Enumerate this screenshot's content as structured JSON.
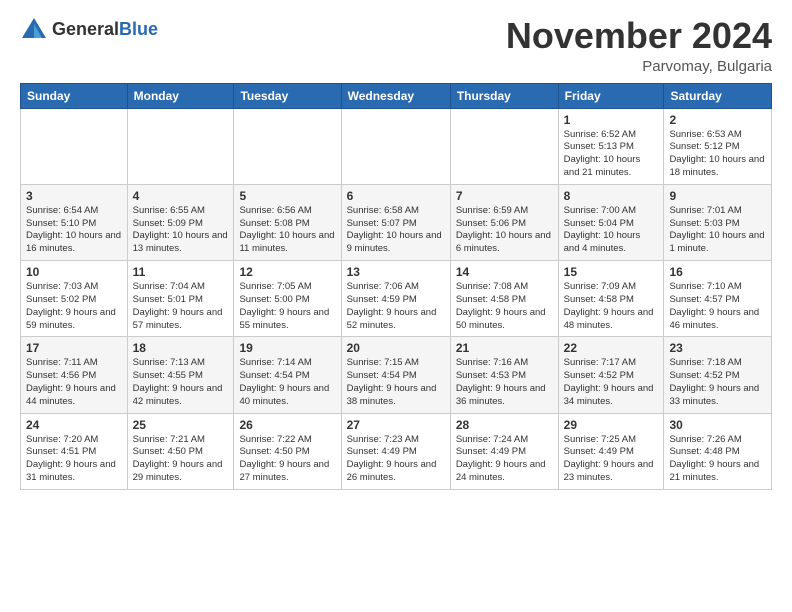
{
  "logo": {
    "text_general": "General",
    "text_blue": "Blue"
  },
  "title": "November 2024",
  "subtitle": "Parvomay, Bulgaria",
  "days_of_week": [
    "Sunday",
    "Monday",
    "Tuesday",
    "Wednesday",
    "Thursday",
    "Friday",
    "Saturday"
  ],
  "weeks": [
    [
      {
        "day": "",
        "info": ""
      },
      {
        "day": "",
        "info": ""
      },
      {
        "day": "",
        "info": ""
      },
      {
        "day": "",
        "info": ""
      },
      {
        "day": "",
        "info": ""
      },
      {
        "day": "1",
        "info": "Sunrise: 6:52 AM\nSunset: 5:13 PM\nDaylight: 10 hours and 21 minutes."
      },
      {
        "day": "2",
        "info": "Sunrise: 6:53 AM\nSunset: 5:12 PM\nDaylight: 10 hours and 18 minutes."
      }
    ],
    [
      {
        "day": "3",
        "info": "Sunrise: 6:54 AM\nSunset: 5:10 PM\nDaylight: 10 hours and 16 minutes."
      },
      {
        "day": "4",
        "info": "Sunrise: 6:55 AM\nSunset: 5:09 PM\nDaylight: 10 hours and 13 minutes."
      },
      {
        "day": "5",
        "info": "Sunrise: 6:56 AM\nSunset: 5:08 PM\nDaylight: 10 hours and 11 minutes."
      },
      {
        "day": "6",
        "info": "Sunrise: 6:58 AM\nSunset: 5:07 PM\nDaylight: 10 hours and 9 minutes."
      },
      {
        "day": "7",
        "info": "Sunrise: 6:59 AM\nSunset: 5:06 PM\nDaylight: 10 hours and 6 minutes."
      },
      {
        "day": "8",
        "info": "Sunrise: 7:00 AM\nSunset: 5:04 PM\nDaylight: 10 hours and 4 minutes."
      },
      {
        "day": "9",
        "info": "Sunrise: 7:01 AM\nSunset: 5:03 PM\nDaylight: 10 hours and 1 minute."
      }
    ],
    [
      {
        "day": "10",
        "info": "Sunrise: 7:03 AM\nSunset: 5:02 PM\nDaylight: 9 hours and 59 minutes."
      },
      {
        "day": "11",
        "info": "Sunrise: 7:04 AM\nSunset: 5:01 PM\nDaylight: 9 hours and 57 minutes."
      },
      {
        "day": "12",
        "info": "Sunrise: 7:05 AM\nSunset: 5:00 PM\nDaylight: 9 hours and 55 minutes."
      },
      {
        "day": "13",
        "info": "Sunrise: 7:06 AM\nSunset: 4:59 PM\nDaylight: 9 hours and 52 minutes."
      },
      {
        "day": "14",
        "info": "Sunrise: 7:08 AM\nSunset: 4:58 PM\nDaylight: 9 hours and 50 minutes."
      },
      {
        "day": "15",
        "info": "Sunrise: 7:09 AM\nSunset: 4:58 PM\nDaylight: 9 hours and 48 minutes."
      },
      {
        "day": "16",
        "info": "Sunrise: 7:10 AM\nSunset: 4:57 PM\nDaylight: 9 hours and 46 minutes."
      }
    ],
    [
      {
        "day": "17",
        "info": "Sunrise: 7:11 AM\nSunset: 4:56 PM\nDaylight: 9 hours and 44 minutes."
      },
      {
        "day": "18",
        "info": "Sunrise: 7:13 AM\nSunset: 4:55 PM\nDaylight: 9 hours and 42 minutes."
      },
      {
        "day": "19",
        "info": "Sunrise: 7:14 AM\nSunset: 4:54 PM\nDaylight: 9 hours and 40 minutes."
      },
      {
        "day": "20",
        "info": "Sunrise: 7:15 AM\nSunset: 4:54 PM\nDaylight: 9 hours and 38 minutes."
      },
      {
        "day": "21",
        "info": "Sunrise: 7:16 AM\nSunset: 4:53 PM\nDaylight: 9 hours and 36 minutes."
      },
      {
        "day": "22",
        "info": "Sunrise: 7:17 AM\nSunset: 4:52 PM\nDaylight: 9 hours and 34 minutes."
      },
      {
        "day": "23",
        "info": "Sunrise: 7:18 AM\nSunset: 4:52 PM\nDaylight: 9 hours and 33 minutes."
      }
    ],
    [
      {
        "day": "24",
        "info": "Sunrise: 7:20 AM\nSunset: 4:51 PM\nDaylight: 9 hours and 31 minutes."
      },
      {
        "day": "25",
        "info": "Sunrise: 7:21 AM\nSunset: 4:50 PM\nDaylight: 9 hours and 29 minutes."
      },
      {
        "day": "26",
        "info": "Sunrise: 7:22 AM\nSunset: 4:50 PM\nDaylight: 9 hours and 27 minutes."
      },
      {
        "day": "27",
        "info": "Sunrise: 7:23 AM\nSunset: 4:49 PM\nDaylight: 9 hours and 26 minutes."
      },
      {
        "day": "28",
        "info": "Sunrise: 7:24 AM\nSunset: 4:49 PM\nDaylight: 9 hours and 24 minutes."
      },
      {
        "day": "29",
        "info": "Sunrise: 7:25 AM\nSunset: 4:49 PM\nDaylight: 9 hours and 23 minutes."
      },
      {
        "day": "30",
        "info": "Sunrise: 7:26 AM\nSunset: 4:48 PM\nDaylight: 9 hours and 21 minutes."
      }
    ]
  ]
}
